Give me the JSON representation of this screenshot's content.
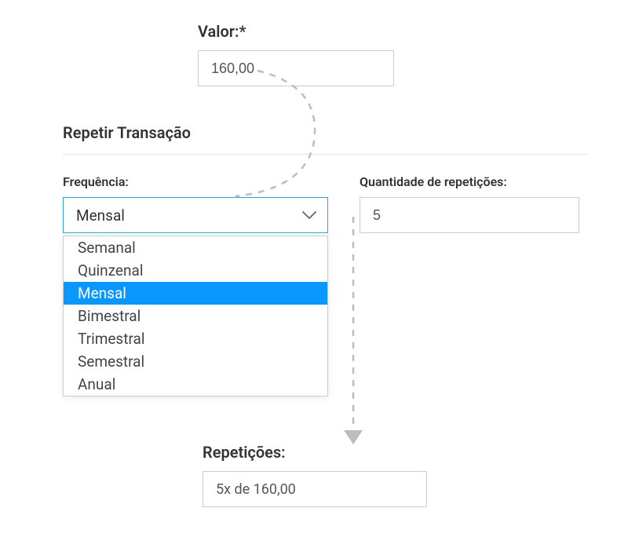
{
  "valor": {
    "label": "Valor:*",
    "value": "160,00"
  },
  "section_title": "Repetir Transação",
  "frequencia": {
    "label": "Frequência:",
    "selected": "Mensal",
    "options": [
      "Semanal",
      "Quinzenal",
      "Mensal",
      "Bimestral",
      "Trimestral",
      "Semestral",
      "Anual"
    ]
  },
  "quantidade": {
    "label": "Quantidade de repetições:",
    "value": "5"
  },
  "resultado": {
    "label": "Repetições:",
    "text": "5x de 160,00"
  }
}
